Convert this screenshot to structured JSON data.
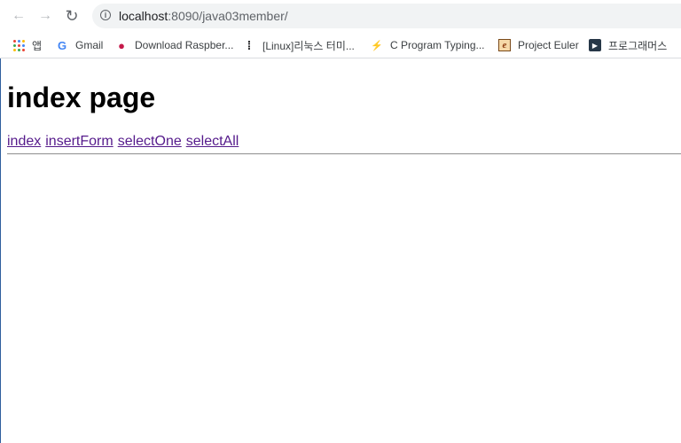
{
  "browser": {
    "url_host": "localhost",
    "url_rest": ":8090/java03member/",
    "nav": {
      "back_icon": "←",
      "forward_icon": "→",
      "reload_icon": "↻"
    }
  },
  "bookmarks": [
    {
      "label": "앱",
      "icon": "apps-grid-icon"
    },
    {
      "label": "Gmail",
      "icon": "google-g-icon",
      "glyph": "G"
    },
    {
      "label": "Download Raspber...",
      "icon": "raspberry-icon",
      "glyph": "●"
    },
    {
      "label": "[Linux]리눅스 터미...",
      "icon": "dots-icon",
      "glyph": "⁞"
    },
    {
      "label": "C Program Typing...",
      "icon": "lightning-icon",
      "glyph": "⚡"
    },
    {
      "label": "Project Euler",
      "icon": "euler-icon",
      "glyph": "e"
    },
    {
      "label": "프로그래머스",
      "icon": "programmers-icon",
      "glyph": "▶"
    }
  ],
  "page": {
    "heading": "index page",
    "links": [
      "index",
      "insertForm",
      "selectOne",
      "selectAll"
    ]
  },
  "colors": {
    "link": "#551a8b",
    "omnibox": "#f1f3f4",
    "google_blue": "#4285f4",
    "raspberry": "#c51a4a"
  }
}
